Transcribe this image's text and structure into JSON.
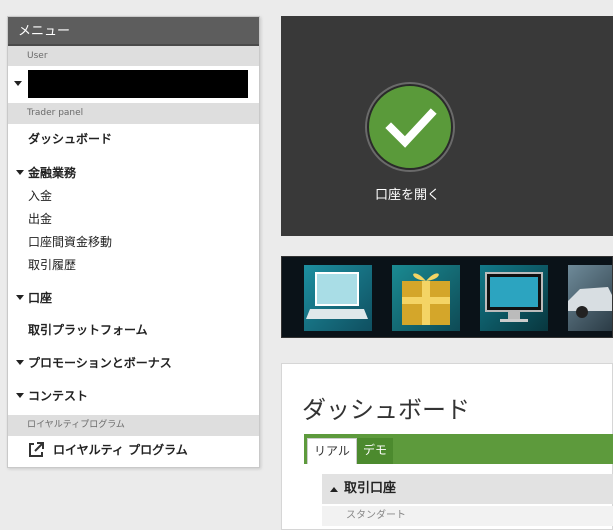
{
  "sidebar": {
    "title": "メニュー",
    "user_section": "User",
    "trader_section": "Trader panel",
    "dashboard": "ダッシュボード",
    "finance_group": "金融業務",
    "finance_items": [
      "入金",
      "出金",
      "口座間資金移動",
      "取引履歴"
    ],
    "accounts_group": "口座",
    "platforms": "取引プラットフォーム",
    "promotions_group": "プロモーションとボーナス",
    "contests_group": "コンテスト",
    "loyalty_section": "ロイヤルティプログラム",
    "loyalty_link": "ロイヤルティ プログラム"
  },
  "open_account": {
    "label": "口座を開く",
    "accent": "#5a9a3a"
  },
  "dashboard": {
    "title": "ダッシュボード",
    "tabs": [
      "リアル",
      "デモ"
    ],
    "accounts_header": "取引口座",
    "accounts_sub": "スタンダート",
    "accent": "#5d9a3c"
  }
}
